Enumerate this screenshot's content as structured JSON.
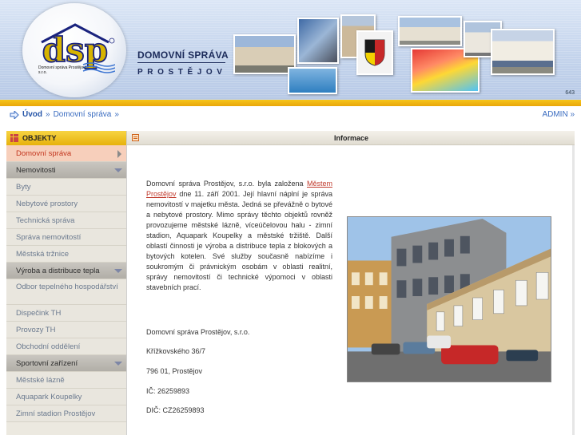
{
  "header": {
    "logo_text": "dsp",
    "logo_subtitle": "Domovní správa Prostějov, s.r.o.",
    "company_name": "DOMOVNÍ SPRÁVA",
    "company_city": "PROSTĚJOV",
    "corner_text": "643"
  },
  "breadcrumb": {
    "home": "Úvod",
    "sep1": "»",
    "current": "Domovní správa",
    "sep2": "»",
    "admin": "ADMIN »"
  },
  "sidebar": {
    "title": "OBJEKTY",
    "items": [
      {
        "label": "Domovní správa",
        "kind": "active"
      },
      {
        "label": "Nemovitosti",
        "kind": "section"
      },
      {
        "label": "Byty",
        "kind": "sub"
      },
      {
        "label": "Nebytové prostory",
        "kind": "sub"
      },
      {
        "label": "Technická správa",
        "kind": "sub"
      },
      {
        "label": "Správa nemovitostí",
        "kind": "sub"
      },
      {
        "label": "Městská tržnice",
        "kind": "sub"
      },
      {
        "label": "Výroba a distribuce tepla",
        "kind": "section"
      },
      {
        "label": "Odbor tepelného hospodářství",
        "kind": "sub"
      },
      {
        "label": "Dispečink TH",
        "kind": "sub"
      },
      {
        "label": "Provozy TH",
        "kind": "sub"
      },
      {
        "label": "Obchodní oddělení",
        "kind": "sub"
      },
      {
        "label": "Sportovní zařízení",
        "kind": "section"
      },
      {
        "label": "Městské lázně",
        "kind": "sub"
      },
      {
        "label": "Aquapark Koupelky",
        "kind": "sub"
      },
      {
        "label": "Zimní stadion Prostějov",
        "kind": "sub"
      }
    ]
  },
  "main": {
    "title": "Informace",
    "para_start": "Domovní správa Prostějov, s.r.o. byla založena",
    "para_link": "Městem Prostějov",
    "para_rest": "dne 11. září 2001. Její hlavní náplní je správa nemovitostí v majetku města. Jedná se převážně o bytové a nebytové prostory. Mimo správy těchto objektů rovněž provozujeme městské lázně, víceúčelovou halu - zimní stadion, Aquapark Koupelky a městské tržiště. Další oblastí činnosti je výroba a distribuce tepla z blokových a bytových kotelen. Své služby současně nabízíme i soukromým či právnickým osobám v oblasti realitní, správy nemovitostí či technické výpomoci v oblasti stavebních prací.",
    "address_name": "Domovní správa Prostějov, s.r.o.",
    "address_street": "Křížkovského 36/7",
    "address_city": "796 01, Prostějov",
    "ico": "IČ: 26259893",
    "dic": "DIČ: CZ26259893"
  },
  "colors": {
    "accent_yellow": "#f0c020",
    "link_blue": "#3a6cc0",
    "link_red": "#c0392b",
    "active_bg": "#f7cfbb"
  }
}
